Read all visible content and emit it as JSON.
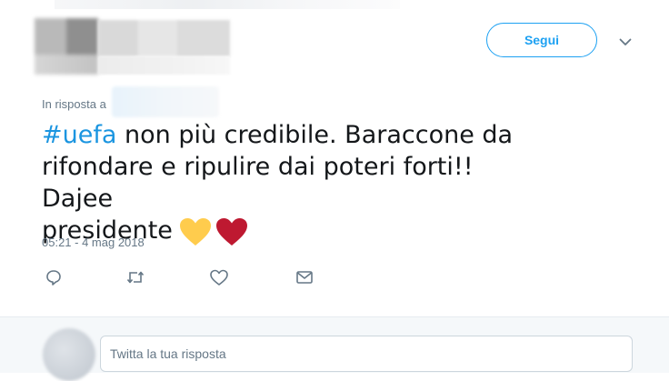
{
  "header": {
    "follow_label": "Segui"
  },
  "reply_context": {
    "prefix": "In risposta a"
  },
  "tweet": {
    "hashtag": "#uefa",
    "line1_rest": " non più credibile. Baraccone da",
    "line2": "rifondare e ripulire dai poteri forti!! Dajee",
    "line3": "presidente",
    "emojis": [
      "yellow-heart",
      "red-heart"
    ],
    "timestamp": "05:21 - 4 mag 2018"
  },
  "actions": [
    "reply-icon",
    "retweet-icon",
    "like-icon",
    "direct-message-icon"
  ],
  "compose": {
    "placeholder": "Twitta la tua risposta"
  },
  "colors": {
    "accent": "#1da1f2",
    "hashtag": "#1b95e0",
    "secondary_text": "#657786",
    "yellow_heart": "#ffcc4d",
    "red_heart": "#be1931"
  }
}
